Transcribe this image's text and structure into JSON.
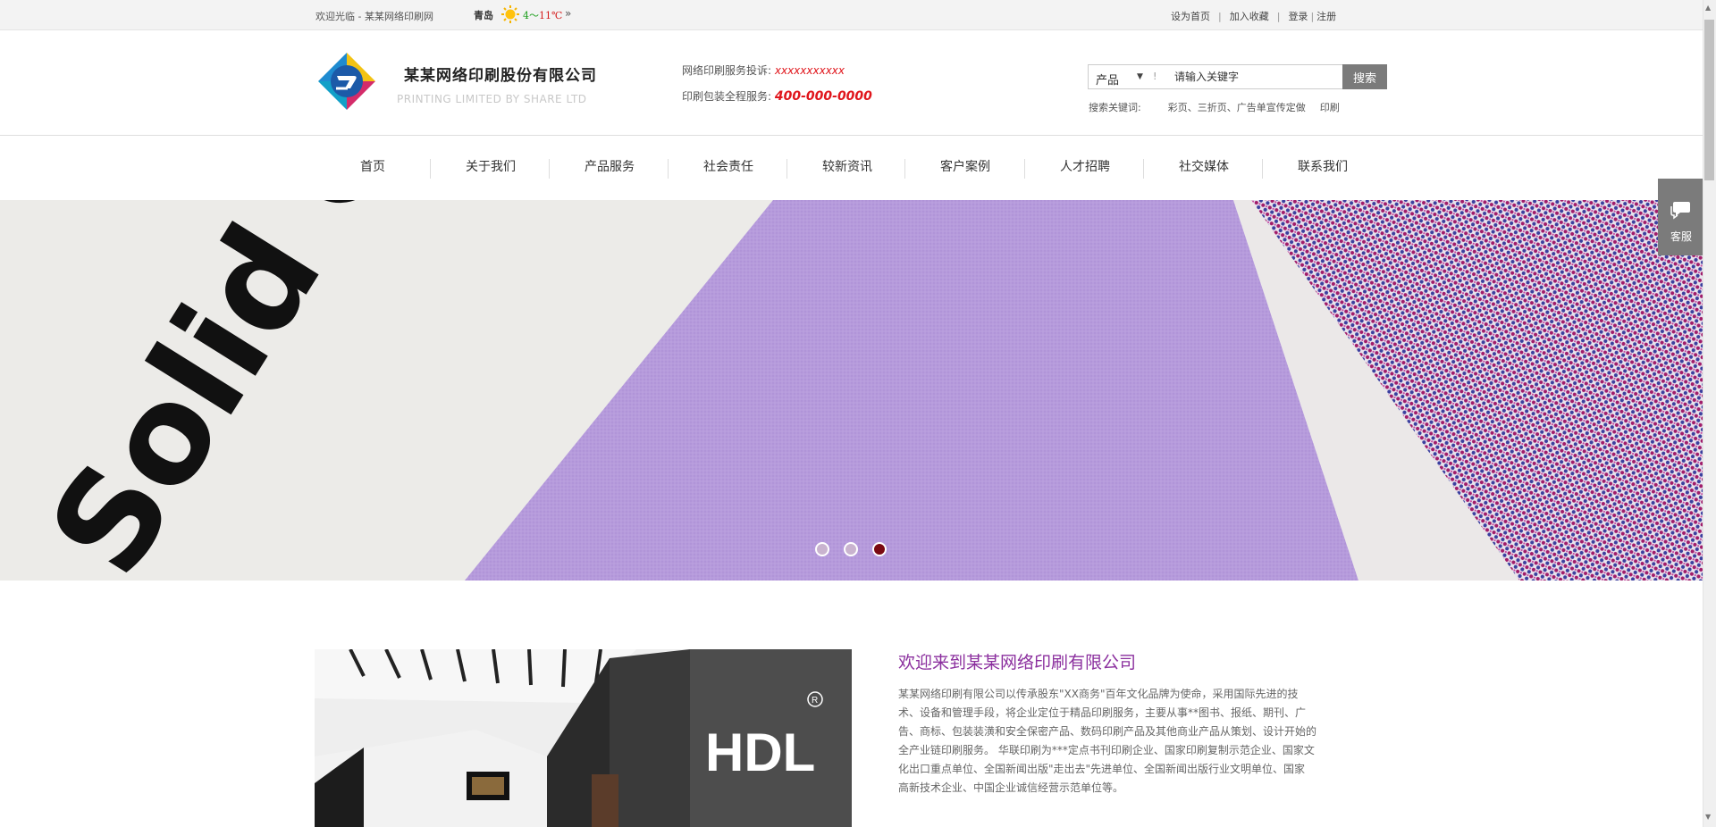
{
  "topbar": {
    "welcome": "欢迎光临 - 某某网络印刷网",
    "weather": {
      "city": "青岛",
      "low": "4",
      "sep": "～",
      "high": "11℃",
      "more": "»"
    },
    "links": {
      "set_home": "设为首页",
      "sep": "|",
      "favorite": "加入收藏",
      "login": "登录",
      "sep2": "|",
      "register": "注册"
    }
  },
  "header": {
    "company_name": "某某网络印刷股份有限公司",
    "company_en": "PRINTING LIMITED BY SHARE LTD",
    "service1_label": "网络印刷服务投诉:",
    "service1_value": "xxxxxxxxxxx",
    "service2_label": "印刷包装全程服务:",
    "service2_value": "400-000-0000"
  },
  "search": {
    "category": "产品",
    "placeholder": "请输入关键字",
    "button": "搜索",
    "keywords_label": "搜索关键词:",
    "keywords": [
      "彩页、三折页、广告单宣传定做",
      "印刷"
    ]
  },
  "nav": {
    "items": [
      "首页",
      "关于我们",
      "产品服务",
      "社会责任",
      "较新资讯",
      "客户案例",
      "人才招聘",
      "社交媒体",
      "联系我们"
    ]
  },
  "banner": {
    "text": "Solid Color",
    "slides": 3,
    "active_slide": 3
  },
  "sidebar": {
    "service_label": "客服"
  },
  "about": {
    "photo_sign": "HDL",
    "photo_mark": "R",
    "title": "欢迎来到某某网络印刷有限公司",
    "lines": [
      "某某网络印刷有限公司以传承股东\"XX商务\"百年文化品牌为使命，采用国际先进的技",
      "术、设备和管理手段，将企业定位于精品印刷服务，主要从事**图书、报纸、期刊、广",
      "告、商标、包装装潢和安全保密产品、数码印刷产品及其他商业产品从策划、设计开始的",
      "全产业链印刷服务。 华联印刷为***定点书刊印刷企业、国家印刷复制示范企业、国家文",
      "化出口重点单位、全国新闻出版\"走出去\"先进单位、全国新闻出版行业文明单位、国家",
      "高新技术企业、中国企业诚信经营示范单位等。"
    ]
  },
  "colors": {
    "accent_purple": "#8b2f9e",
    "red": "#e0161c",
    "button_gray": "#7b7b7b",
    "dot_active": "#7a0a12"
  }
}
